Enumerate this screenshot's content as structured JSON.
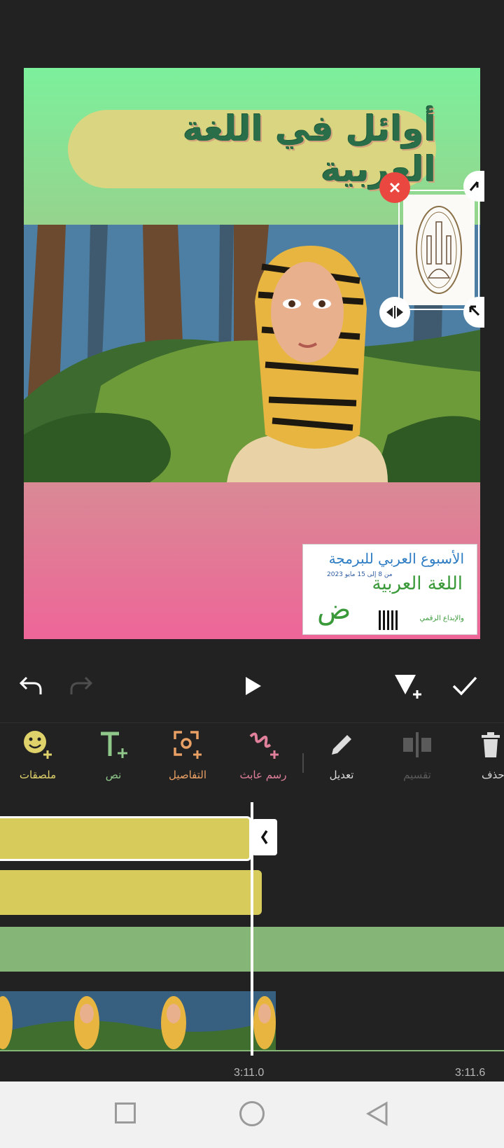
{
  "preview": {
    "title_text": "أوائل في اللغة العربية",
    "logo_card": {
      "line1": "الأسبوع العربي للبرمجة",
      "line2": "من 8 إلى 15 مايو 2023",
      "line3": "اللغة العربية",
      "line4": "والإبداع الرقمي"
    },
    "sticker_logo_text": "AL-AZHAR AL-SHARIF",
    "colors": {
      "top_gradient": "#7cf09c",
      "bottom_gradient": "#ee6598",
      "title_pill": "#d9d580",
      "title_text": "#2a6e49"
    }
  },
  "controls": {
    "undo_icon": "undo-icon",
    "redo_icon": "redo-icon",
    "play_icon": "play-icon",
    "add_keyframe_icon": "keyframe-add-icon",
    "confirm_icon": "check-icon"
  },
  "tools": [
    {
      "id": "stickers",
      "label": "ملصقات",
      "icon": "emoji-add-icon",
      "color": "#e0d26a"
    },
    {
      "id": "text",
      "label": "نص",
      "icon": "text-add-icon",
      "color": "#8fc88a"
    },
    {
      "id": "details",
      "label": "التفاصيل",
      "icon": "focus-add-icon",
      "color": "#e8a064"
    },
    {
      "id": "doodle",
      "label": "رسم عابث",
      "icon": "doodle-add-icon",
      "color": "#e0809b"
    },
    {
      "id": "edit",
      "label": "تعديل",
      "icon": "pencil-icon",
      "color": "#dddddd"
    },
    {
      "id": "split",
      "label": "تقسيم",
      "icon": "split-icon",
      "color": "#5a5a5a"
    },
    {
      "id": "delete",
      "label": "حذف",
      "icon": "trash-icon",
      "color": "#dddddd"
    }
  ],
  "timeline": {
    "timestamps": [
      "3:11.0",
      "3:11.6"
    ],
    "track_colors": {
      "sticker": "#d6cb5b",
      "overlay": "#86b677"
    }
  }
}
